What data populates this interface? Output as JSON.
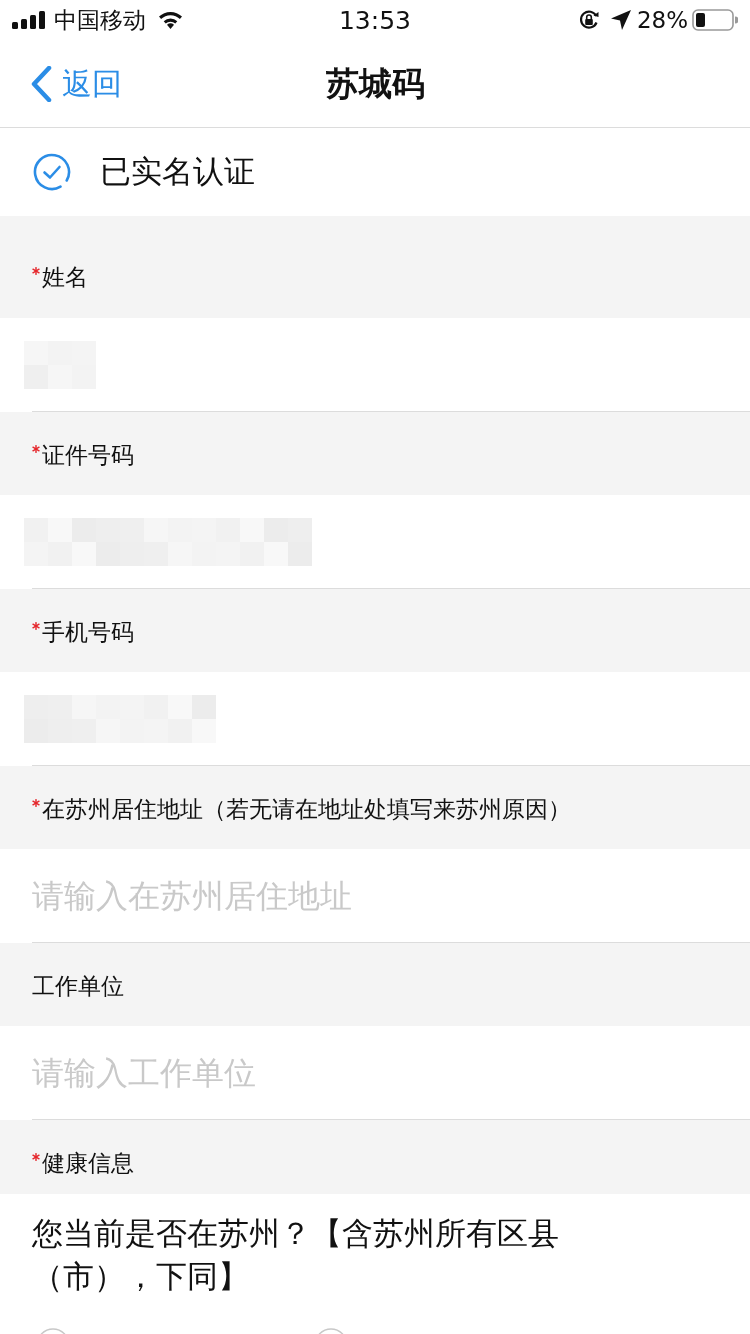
{
  "status_bar": {
    "carrier": "中国移动",
    "time": "13:53",
    "battery": "28%"
  },
  "nav": {
    "back": "返回",
    "title": "苏城码"
  },
  "verification": {
    "verified": true,
    "label": "已实名认证"
  },
  "fields": [
    {
      "label": "姓名",
      "required": true,
      "kind": "masked-name"
    },
    {
      "label": "证件号码",
      "required": true,
      "kind": "masked-id"
    },
    {
      "label": "手机号码",
      "required": true,
      "kind": "masked-phone"
    },
    {
      "label": "在苏州居住地址（若无请在地址处填写来苏州原因）",
      "required": true,
      "kind": "text",
      "placeholder": "请输入在苏州居住地址"
    },
    {
      "label": "工作单位",
      "required": false,
      "kind": "text",
      "placeholder": "请输入工作单位"
    }
  ],
  "health": {
    "label": "健康信息",
    "required": true,
    "question": "您当前是否在苏州？【含苏州所有区县（市），下同】"
  }
}
